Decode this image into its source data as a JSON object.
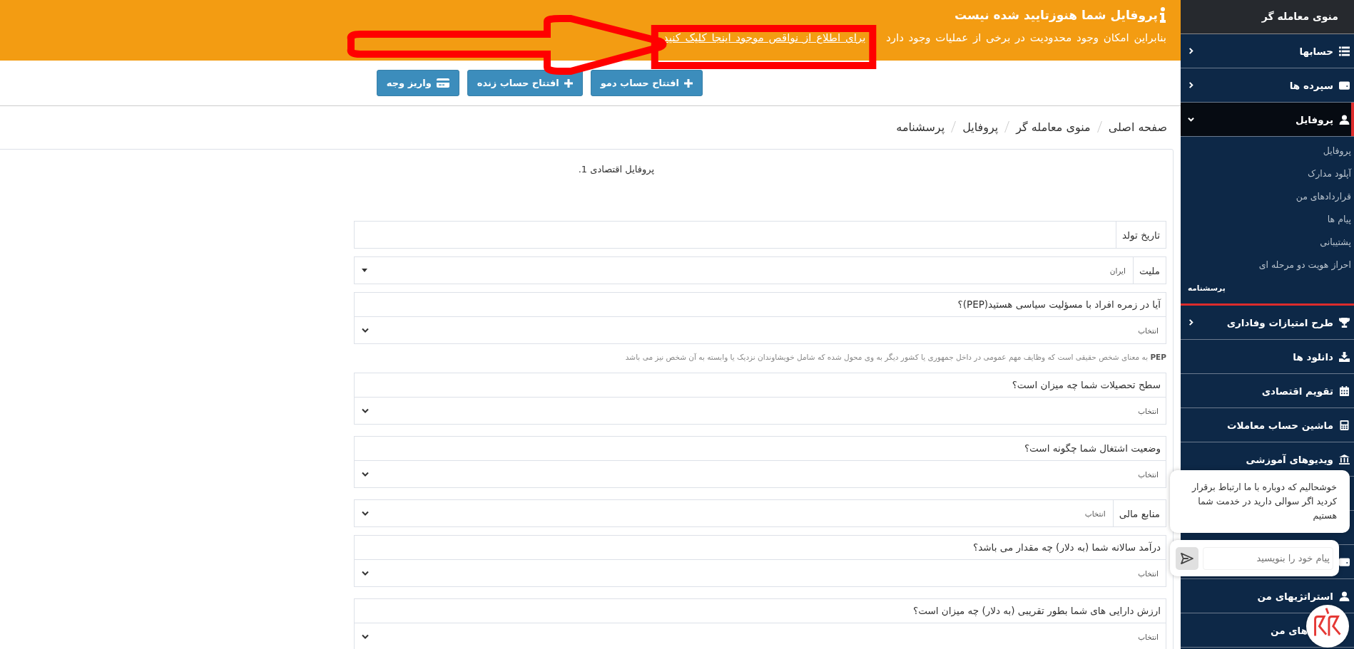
{
  "notice": {
    "title": "پروفایل شما هنوزتایید شده نیست",
    "text": "بنابراین امکان وجود محدودیت در برخی از عملیات وجود دارد",
    "link": "برای اطلاع از نواقص موجود اینجا کلیک کنید"
  },
  "actions": [
    {
      "label": "افتتاح حساب دمو",
      "kind": "plus"
    },
    {
      "label": "افتتاح حساب زنده",
      "kind": "plus"
    },
    {
      "label": "واریز وجه",
      "kind": "card"
    }
  ],
  "breadcrumb": [
    "صفحه اصلی",
    "منوی معامله گر",
    "پروفایل",
    "پرسشنامه"
  ],
  "form": {
    "title": "پروفایل اقتصادی 1.",
    "fields": [
      {
        "kind": "input",
        "label": "تاریخ تولد"
      },
      {
        "kind": "dropdown",
        "label": "ملیت",
        "value": "ایران"
      },
      {
        "kind": "question",
        "label": "آیا در زمره افراد با مسؤلیت سیاسی هستید(PEP)؟",
        "value": "انتخاب",
        "help": "**PEP** به معنای شخص حقیقی است که وظایف مهم عمومی در داخل جمهوری یا کشور دیگر به وی محول شده که شامل خویشاوندان نزدیک یا وابسته به آن شخص نیز می باشد"
      },
      {
        "kind": "question",
        "label": "سطح تحصیلات شما چه میزان است؟",
        "value": "انتخاب"
      },
      {
        "kind": "question",
        "label": "وضعیت اشتغال شما چگونه است؟",
        "value": "انتخاب"
      },
      {
        "kind": "select",
        "label": "منابع مالی",
        "value": "انتخاب"
      },
      {
        "kind": "question",
        "label": "درآمد سالانه شما (به دلار) چه مقدار می باشد؟",
        "value": "انتخاب"
      },
      {
        "kind": "question",
        "label": "ارزش دارایی های شما بطور تقریبی (به دلار) چه میزان است؟",
        "value": "انتخاب"
      }
    ]
  },
  "sidebar": {
    "title": "منوی معامله گر",
    "items": [
      {
        "kind": "menu",
        "label": "حسابها",
        "expanded": false,
        "selected": false
      },
      {
        "kind": "menu",
        "label": "سپرده ها",
        "expanded": false,
        "selected": false
      },
      {
        "kind": "menu",
        "label": "پروفایل",
        "expanded": true,
        "selected": true,
        "children": [
          {
            "label": "پروفایل",
            "selected": false
          },
          {
            "label": "آپلود مدارک",
            "selected": false
          },
          {
            "label": "قراردادهای من",
            "selected": false
          },
          {
            "label": "پیام ها",
            "selected": false
          },
          {
            "label": "پشتیبانی",
            "selected": false
          },
          {
            "label": "احراز هویت دو مرحله ای",
            "selected": false
          },
          {
            "label": "پرسشنامه",
            "selected": true
          }
        ]
      },
      {
        "kind": "menu",
        "label": "طرح امتیازات وفاداری",
        "expanded": false,
        "selected": false
      },
      {
        "kind": "link",
        "label": "دانلود ها",
        "selected": false
      },
      {
        "kind": "link",
        "label": "تقویم اقتصادی",
        "selected": false
      },
      {
        "kind": "link",
        "label": "ماشین حساب معاملات",
        "selected": false
      },
      {
        "kind": "link",
        "label": "ویدیوهای آموزشی",
        "selected": false
      },
      {
        "kind": "covered"
      },
      {
        "kind": "covered"
      },
      {
        "kind": "covered-icon"
      },
      {
        "kind": "link",
        "label": "استراتژیهای من",
        "selected": false
      },
      {
        "kind": "partial",
        "label": "های من",
        "selected": false
      }
    ]
  },
  "chat": {
    "message": "خوشحالیم که دوباره با ما ارتباط برقرار کردید اگر سوالی دارید در خدمت شما هستیم",
    "placeholder": "پیام خود را بنویسید"
  }
}
